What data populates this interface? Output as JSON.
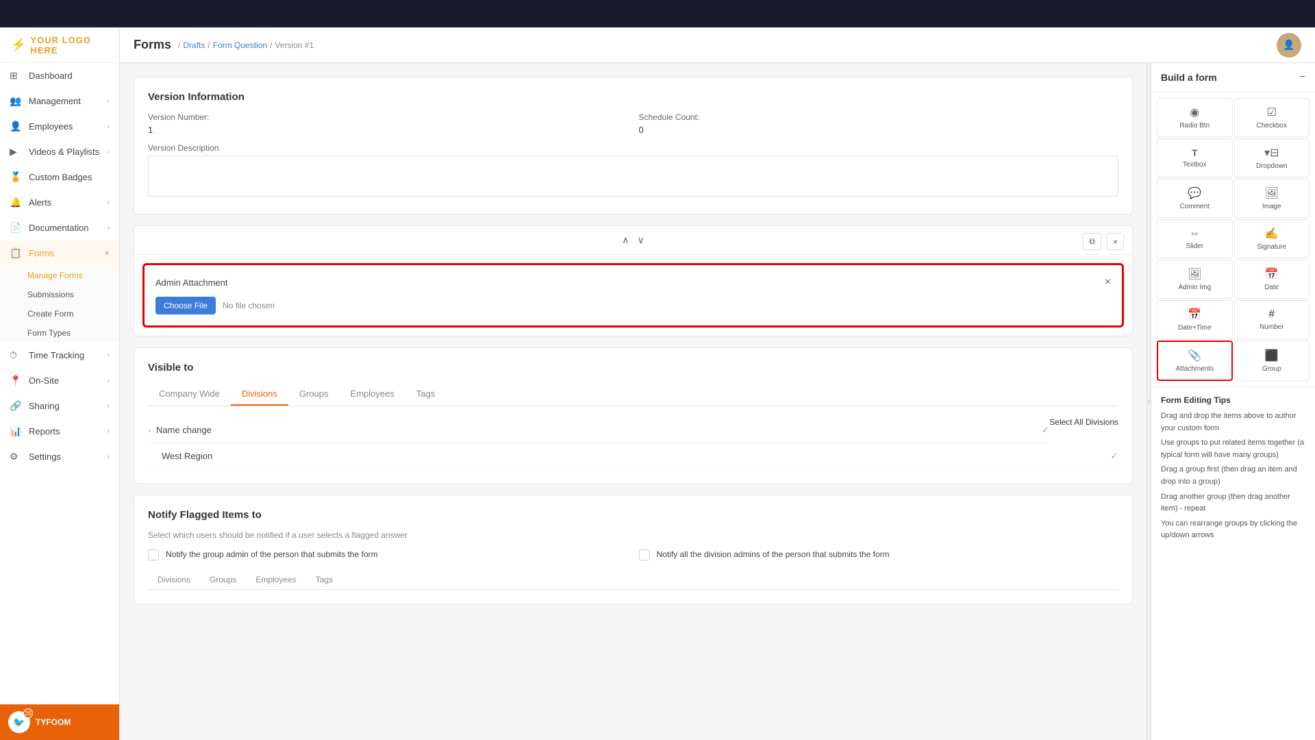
{
  "app": {
    "topbar_bg": "#1a1a2e",
    "logo_text": "YOUR LOGO HERE"
  },
  "sidebar": {
    "items": [
      {
        "id": "dashboard",
        "label": "Dashboard",
        "icon": "⊞",
        "has_chevron": false
      },
      {
        "id": "management",
        "label": "Management",
        "icon": "👥",
        "has_chevron": true
      },
      {
        "id": "employees",
        "label": "Employees",
        "icon": "👤",
        "has_chevron": true
      },
      {
        "id": "videos",
        "label": "Videos & Playlists",
        "icon": "▶",
        "has_chevron": true
      },
      {
        "id": "custom-badges",
        "label": "Custom Badges",
        "icon": "🏅",
        "has_chevron": false
      },
      {
        "id": "alerts",
        "label": "Alerts",
        "icon": "🔔",
        "has_chevron": true
      },
      {
        "id": "documentation",
        "label": "Documentation",
        "icon": "📄",
        "has_chevron": true
      },
      {
        "id": "forms",
        "label": "Forms",
        "icon": "📋",
        "has_chevron": true,
        "active": true
      },
      {
        "id": "time-tracking",
        "label": "Time Tracking",
        "icon": "⏱",
        "has_chevron": true
      },
      {
        "id": "on-site",
        "label": "On-Site",
        "icon": "📍",
        "has_chevron": true
      },
      {
        "id": "sharing",
        "label": "Sharing",
        "icon": "🔗",
        "has_chevron": true
      },
      {
        "id": "reports",
        "label": "Reports",
        "icon": "📊",
        "has_chevron": true
      },
      {
        "id": "settings",
        "label": "Settings",
        "icon": "⚙",
        "has_chevron": true
      }
    ],
    "forms_sub": [
      {
        "id": "manage-forms",
        "label": "Manage Forms",
        "active": true
      },
      {
        "id": "submissions",
        "label": "Submissions"
      },
      {
        "id": "create-form",
        "label": "Create Form"
      },
      {
        "id": "form-types",
        "label": "Form Types"
      }
    ],
    "bottom_badge": "26",
    "bottom_label": "TYFOOM"
  },
  "header": {
    "title": "Forms",
    "breadcrumb": [
      "Drafts",
      "Form Question",
      "Version #1"
    ]
  },
  "version_info": {
    "section_title": "Version Information",
    "version_number_label": "Version Number:",
    "version_number_value": "1",
    "schedule_count_label": "Schedule Count:",
    "schedule_count_value": "0",
    "description_label": "Version Description",
    "description_placeholder": ""
  },
  "attachment_modal": {
    "title": "Admin Attachment",
    "choose_file_label": "Choose File",
    "no_file_label": "No file chosen",
    "close_icon": "×"
  },
  "visible_to": {
    "section_title": "Visible to",
    "tabs": [
      "Company Wide",
      "Divisions",
      "Groups",
      "Employees",
      "Tags"
    ],
    "active_tab": "Divisions",
    "select_all_label": "Select All Divisions",
    "divisions": [
      {
        "name": "Name change",
        "checked": true
      },
      {
        "name": "West Region",
        "checked": true
      }
    ]
  },
  "notify": {
    "section_title": "Notify Flagged Items to",
    "description": "Select which users should be notified if a user selects a flagged answer",
    "items": [
      {
        "label": "Notify the group admin of the person that submits the form"
      },
      {
        "label": "Notify all the division admins of the person that submits the form"
      }
    ],
    "tabs": [
      "Divisions",
      "Groups",
      "Employees",
      "Tags"
    ]
  },
  "right_panel": {
    "title": "Build a form",
    "tools": [
      {
        "id": "radio-btn",
        "label": "Radio Btn",
        "icon": "◉"
      },
      {
        "id": "checkbox",
        "label": "Checkbox",
        "icon": "☑"
      },
      {
        "id": "textbox",
        "label": "Textbox",
        "icon": "T"
      },
      {
        "id": "dropdown",
        "label": "Dropdown",
        "icon": "⊞"
      },
      {
        "id": "comment",
        "label": "Comment",
        "icon": "💬"
      },
      {
        "id": "image",
        "label": "Image",
        "icon": "🖼"
      },
      {
        "id": "slider",
        "label": "Slider",
        "icon": "⊸"
      },
      {
        "id": "signature",
        "label": "Signature",
        "icon": "✍"
      },
      {
        "id": "admin-img",
        "label": "Admin Img",
        "icon": "🖼"
      },
      {
        "id": "date",
        "label": "Date",
        "icon": "📅"
      },
      {
        "id": "date-time",
        "label": "Date+Time",
        "icon": "📅"
      },
      {
        "id": "number",
        "label": "Number",
        "icon": "#"
      },
      {
        "id": "attachments",
        "label": "Attachments",
        "icon": "📎",
        "highlighted": true
      },
      {
        "id": "group",
        "label": "Group",
        "icon": "⬛"
      }
    ],
    "tips_title": "Form Editing Tips",
    "tips": [
      "Drag and drop the items above to author your custom form",
      "Use groups to put related items together (a typical form will have many groups)",
      "Drag a group first (then drag an item and drop into a group)",
      "Drag another group (then drag another item) - repeat",
      "You can rearrange groups by clicking the up/down arrows"
    ]
  }
}
